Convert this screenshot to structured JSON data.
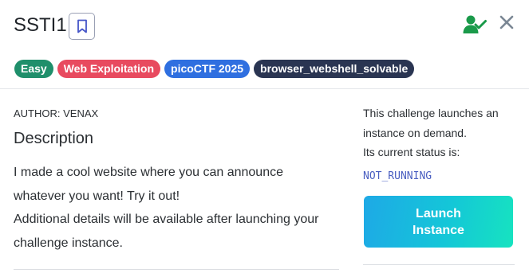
{
  "challenge": {
    "title": "SSTI1",
    "author_label": "AUTHOR: VENAX",
    "description_heading": "Description",
    "description_lines": [
      "I made a cool website where you can announce",
      "whatever you want! Try it out!",
      "Additional details will be available after launching your",
      "challenge instance."
    ]
  },
  "tags": [
    {
      "label": "Easy",
      "color": "#1f8f6b"
    },
    {
      "label": "Web Exploitation",
      "color": "#e84a5f"
    },
    {
      "label": "picoCTF 2025",
      "color": "#2f6fe0"
    },
    {
      "label": "browser_webshell_solvable",
      "color": "#2a3552"
    }
  ],
  "icons": {
    "bookmark": "bookmark-icon",
    "solved": "user-check-icon",
    "close": "close-icon"
  },
  "instance": {
    "info_lines": [
      "This challenge launches an",
      "instance on demand.",
      "Its current status is:"
    ],
    "status": "NOT_RUNNING",
    "launch_label": "Launch Instance"
  },
  "colors": {
    "solved_green": "#1a9a4a",
    "status_blue": "#4a5fc1",
    "launch_gradient_start": "#1ea9e6",
    "launch_gradient_end": "#16e3c0"
  }
}
